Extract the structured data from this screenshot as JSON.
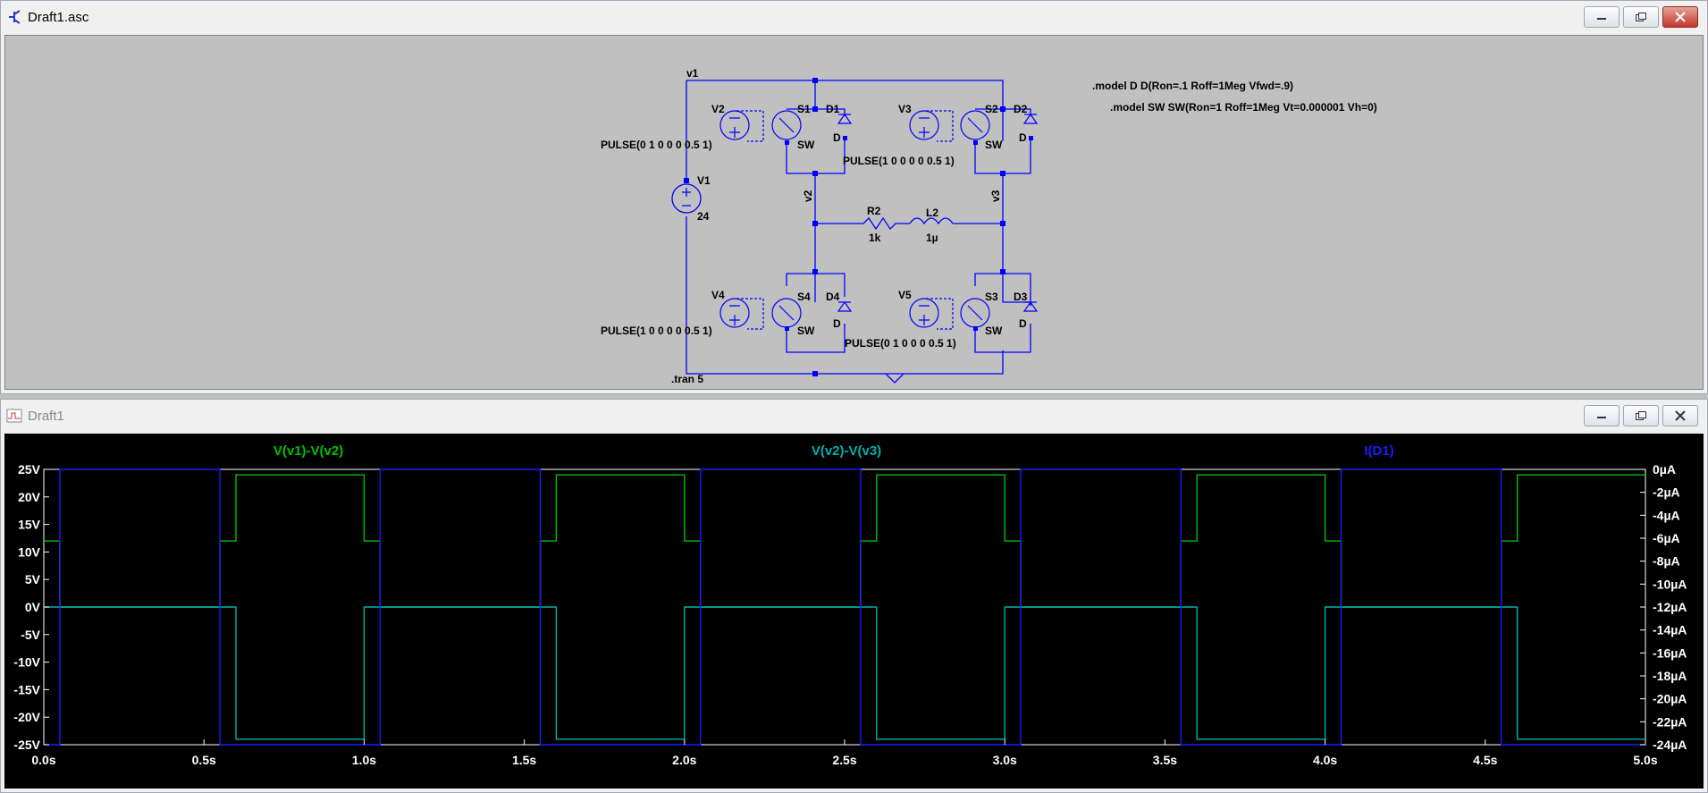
{
  "schematic_window": {
    "title": "Draft1.asc",
    "background": "#c0c0c0",
    "wire_color": "#0000ff",
    "labels": {
      "net_v1": "v1",
      "net_v2": "v2",
      "net_v3": "v3",
      "V1_name": "V1",
      "V1_value": "24",
      "V2_name": "V2",
      "V2_value": "PULSE(0 1 0 0 0 0.5 1)",
      "V3_name": "V3",
      "V3_value": "PULSE(1 0 0 0 0 0.5 1)",
      "V4_name": "V4",
      "V4_value": "PULSE(1 0 0 0 0 0.5 1)",
      "V5_name": "V5",
      "V5_value": "PULSE(0 1 0 0 0 0.5 1)",
      "S1_name": "S1",
      "S2_name": "S2",
      "S3_name": "S3",
      "S4_name": "S4",
      "switch_model": "SW",
      "D1_name": "D1",
      "D2_name": "D2",
      "D3_name": "D3",
      "D4_name": "D4",
      "diode_model": "D",
      "R2_name": "R2",
      "R2_value": "1k",
      "L2_name": "L2",
      "L2_value": "1µ",
      "model_d": ".model D D(Ron=.1 Roff=1Meg Vfwd=.9)",
      "model_sw": ".model SW SW(Ron=1 Roff=1Meg Vt=0.000001 Vh=0)",
      "tran": ".tran 5"
    }
  },
  "waveform_window": {
    "title": "Draft1",
    "background": "#000000"
  },
  "chart_data": {
    "type": "line",
    "series": [
      {
        "name": "V(v1)-V(v2)",
        "color": "#00c000",
        "axis": "left",
        "x": [
          0,
          0.05,
          0.05,
          0.55,
          0.55,
          0.6,
          0.6,
          1.0,
          1.0,
          1.05,
          1.05,
          1.55,
          1.55,
          1.6,
          1.6,
          2.0,
          2.0,
          2.05,
          2.05,
          2.55,
          2.55,
          2.6,
          2.6,
          3.0,
          3.0,
          3.05,
          3.05,
          3.55,
          3.55,
          3.6,
          3.6,
          4.0,
          4.0,
          4.05,
          4.05,
          4.55,
          4.55,
          4.6,
          4.6,
          5.0
        ],
        "y": [
          12,
          12,
          0,
          0,
          12,
          12,
          24,
          24,
          12,
          12,
          0,
          0,
          12,
          12,
          24,
          24,
          12,
          12,
          0,
          0,
          12,
          12,
          24,
          24,
          12,
          12,
          0,
          0,
          12,
          12,
          24,
          24,
          12,
          12,
          0,
          0,
          12,
          12,
          24,
          24
        ]
      },
      {
        "name": "V(v2)-V(v3)",
        "color": "#00b0b0",
        "axis": "left",
        "x": [
          0,
          0.6,
          0.6,
          1.0,
          1.0,
          1.6,
          1.6,
          2.0,
          2.0,
          2.6,
          2.6,
          3.0,
          3.0,
          3.6,
          3.6,
          4.0,
          4.0,
          4.6,
          4.6,
          5.0
        ],
        "y": [
          0,
          0,
          -24,
          -24,
          0,
          0,
          -24,
          -24,
          0,
          0,
          -24,
          -24,
          0,
          0,
          -24,
          -24,
          0,
          0,
          -24,
          -24
        ]
      },
      {
        "name": "I(D1)",
        "color": "#1a1aff",
        "axis": "right",
        "x": [
          0,
          0.05,
          0.05,
          0.55,
          0.55,
          1.05,
          1.05,
          1.55,
          1.55,
          2.05,
          2.05,
          2.55,
          2.55,
          3.05,
          3.05,
          3.55,
          3.55,
          4.05,
          4.05,
          4.55,
          4.55,
          5.0
        ],
        "y": [
          -24,
          -24,
          0,
          0,
          -24,
          -24,
          0,
          0,
          -24,
          -24,
          0,
          0,
          -24,
          -24,
          0,
          0,
          -24,
          -24,
          0,
          0,
          -24,
          -24
        ]
      }
    ],
    "xlim": [
      0,
      5
    ],
    "ylim_left": [
      -25,
      25
    ],
    "ylim_right": [
      -24,
      0
    ],
    "x_ticks": [
      "0.0s",
      "0.5s",
      "1.0s",
      "1.5s",
      "2.0s",
      "2.5s",
      "3.0s",
      "3.5s",
      "4.0s",
      "4.5s",
      "5.0s"
    ],
    "y_ticks_left": [
      "25V",
      "20V",
      "15V",
      "10V",
      "5V",
      "0V",
      "-5V",
      "-10V",
      "-15V",
      "-20V",
      "-25V"
    ],
    "y_ticks_right": [
      "0µA",
      "-2µA",
      "-4µA",
      "-6µA",
      "-8µA",
      "-10µA",
      "-12µA",
      "-14µA",
      "-16µA",
      "-18µA",
      "-20µA",
      "-22µA",
      "-24µA"
    ],
    "grid": false,
    "axis_color": "#ffffff"
  }
}
